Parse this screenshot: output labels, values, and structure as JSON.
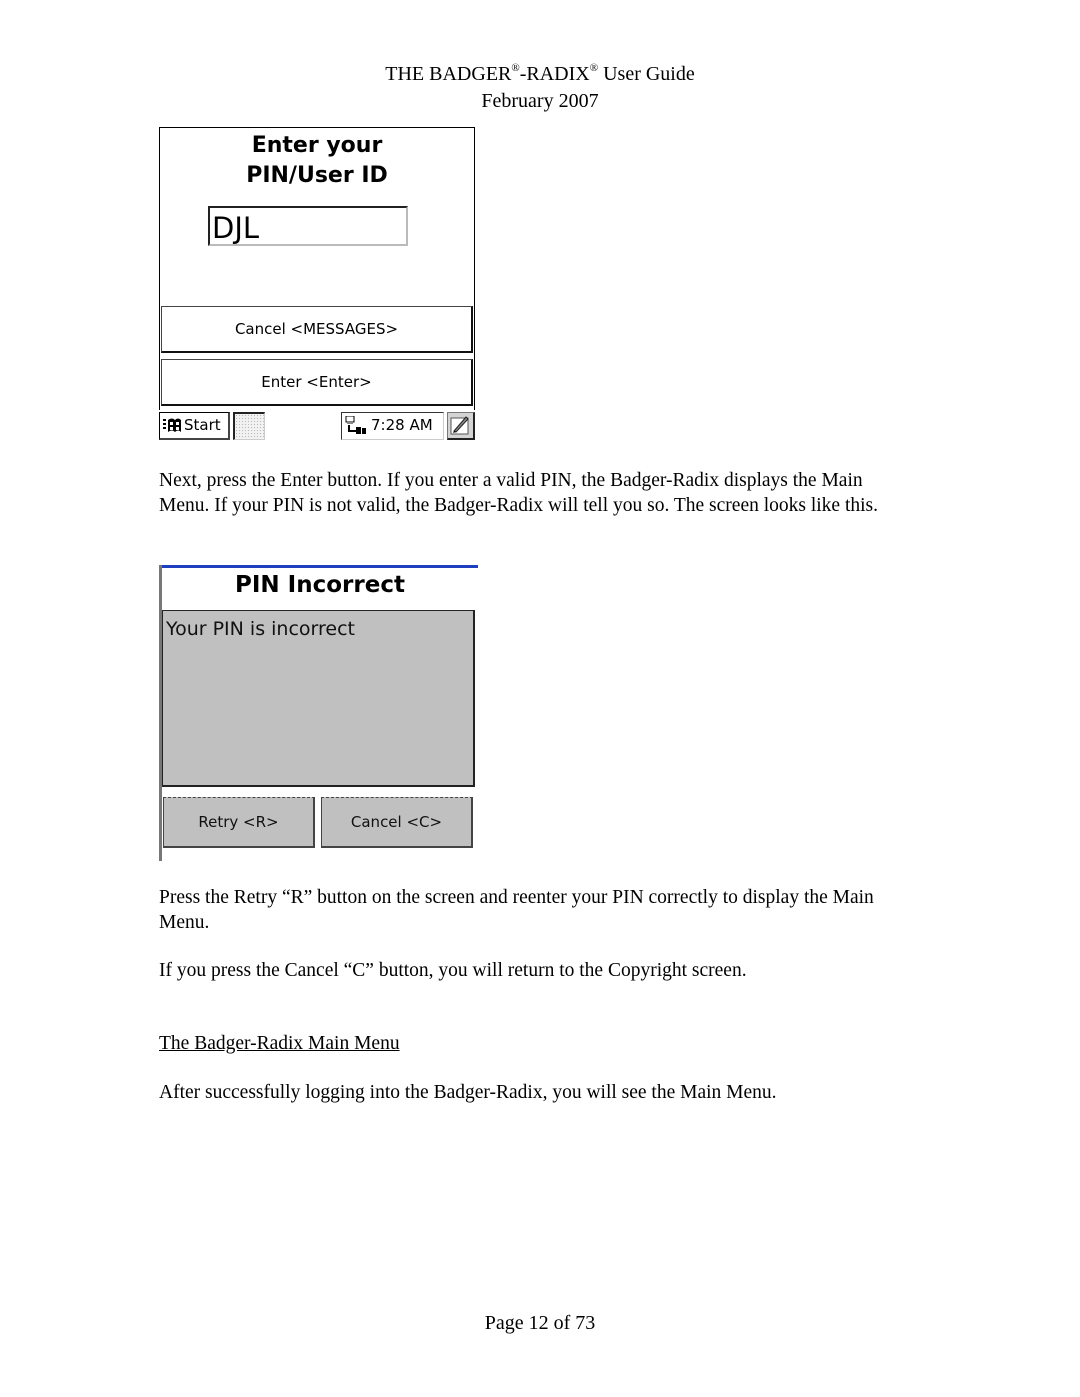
{
  "header": {
    "title_part1": "THE BADGER",
    "reg_mark": "®",
    "title_part2": "-RADIX",
    "title_part3": " User Guide",
    "date": "February 2007"
  },
  "screen_login": {
    "title_line1": "Enter your",
    "title_line2": "PIN/User ID",
    "pin_value": "DJL",
    "cancel_button": "Cancel <MESSAGES>",
    "enter_button": "Enter <Enter>",
    "taskbar": {
      "start_label": "Start",
      "start_icon": "windows-flag-icon",
      "clock": "7:28 AM",
      "network_icon": "network-connection-icon",
      "sip_icon": "input-panel-pen-icon"
    }
  },
  "paragraph1": "Next, press the Enter button.  If you enter a valid PIN, the Badger-Radix displays the Main Menu.  If your PIN is not valid, the Badger-Radix will tell you so.  The screen looks like this.",
  "screen_error": {
    "title": "PIN Incorrect",
    "message": "Your PIN is incorrect",
    "retry_button": "Retry <R>",
    "cancel_button": "Cancel <C>",
    "accent_color": "#1f3fbf",
    "panel_color": "#c0c0c0"
  },
  "paragraph2": "Press the Retry “R” button on the screen and reenter your PIN correctly to display the Main Menu.",
  "paragraph3": "If you press the Cancel “C” button, you will return to the Copyright screen.",
  "section_heading": "The Badger-Radix Main Menu",
  "paragraph4": "After successfully logging into the Badger-Radix, you will see the Main Menu.",
  "footer": {
    "page_label": "Page 12 of 73"
  }
}
